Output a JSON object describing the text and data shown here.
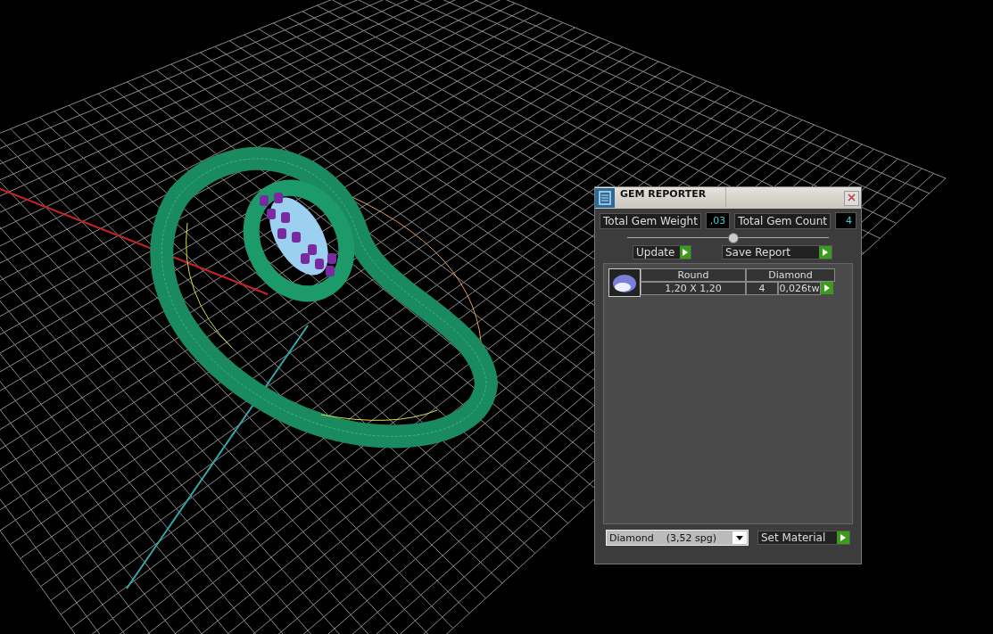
{
  "panel": {
    "title": "GEM REPORTER",
    "total_weight": {
      "label": "Total Gem Weight",
      "value": ",03"
    },
    "total_count": {
      "label": "Total Gem Count",
      "value": "4"
    },
    "buttons": [
      {
        "label": "Update"
      },
      {
        "label": "Save Report"
      }
    ],
    "gems": [
      {
        "shape": "Round",
        "material": "Diamond",
        "size": "1,20 X 1,20",
        "count": "4",
        "weight": "0,026tw"
      }
    ],
    "material_select": {
      "value": "Diamond    (3,52 spg)"
    },
    "set_material": {
      "label": "Set Material"
    }
  }
}
